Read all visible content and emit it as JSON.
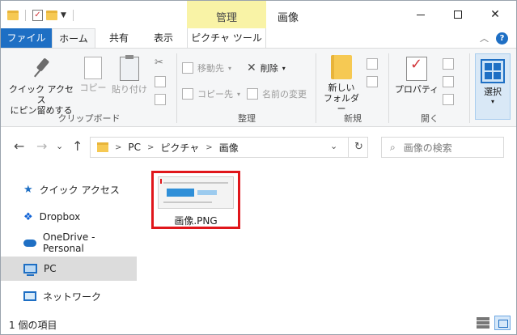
{
  "window": {
    "title": "画像",
    "context_tab_header": "管理",
    "close_glyph": "✕"
  },
  "ribbon_tabs": {
    "file": "ファイル",
    "home": "ホーム",
    "share": "共有",
    "view": "表示",
    "picture_tools": "ピクチャ ツール"
  },
  "ribbon": {
    "clipboard": {
      "label": "クリップボード",
      "quick_access_line1": "クイック アクセス",
      "quick_access_line2": "にピン留めする",
      "copy": "コピー",
      "paste": "貼り付け"
    },
    "organize": {
      "label": "整理",
      "move_to": "移動先",
      "copy_to": "コピー先",
      "delete": "削除",
      "rename": "名前の変更"
    },
    "new": {
      "label": "新規",
      "new_folder_line1": "新しい",
      "new_folder_line2": "フォルダー"
    },
    "open": {
      "label": "開く",
      "properties": "プロパティ"
    },
    "select": {
      "label": "選択"
    }
  },
  "address_bar": {
    "crumbs": [
      "PC",
      "ピクチャ",
      "画像"
    ],
    "search_placeholder": "画像の検索"
  },
  "nav_pane": {
    "items": [
      {
        "label": "クイック アクセス"
      },
      {
        "label": "Dropbox"
      },
      {
        "label": "OneDrive - Personal"
      },
      {
        "label": "PC"
      },
      {
        "label": "ネットワーク"
      }
    ]
  },
  "content": {
    "files": [
      {
        "name": "画像.PNG"
      }
    ]
  },
  "status_bar": {
    "item_count": "1 個の項目"
  },
  "colors": {
    "file_tab": "#1e6fc4",
    "context_tab": "#f9f3a6",
    "highlight_border": "#e0161b",
    "selected_nav": "#dcdcdc"
  }
}
